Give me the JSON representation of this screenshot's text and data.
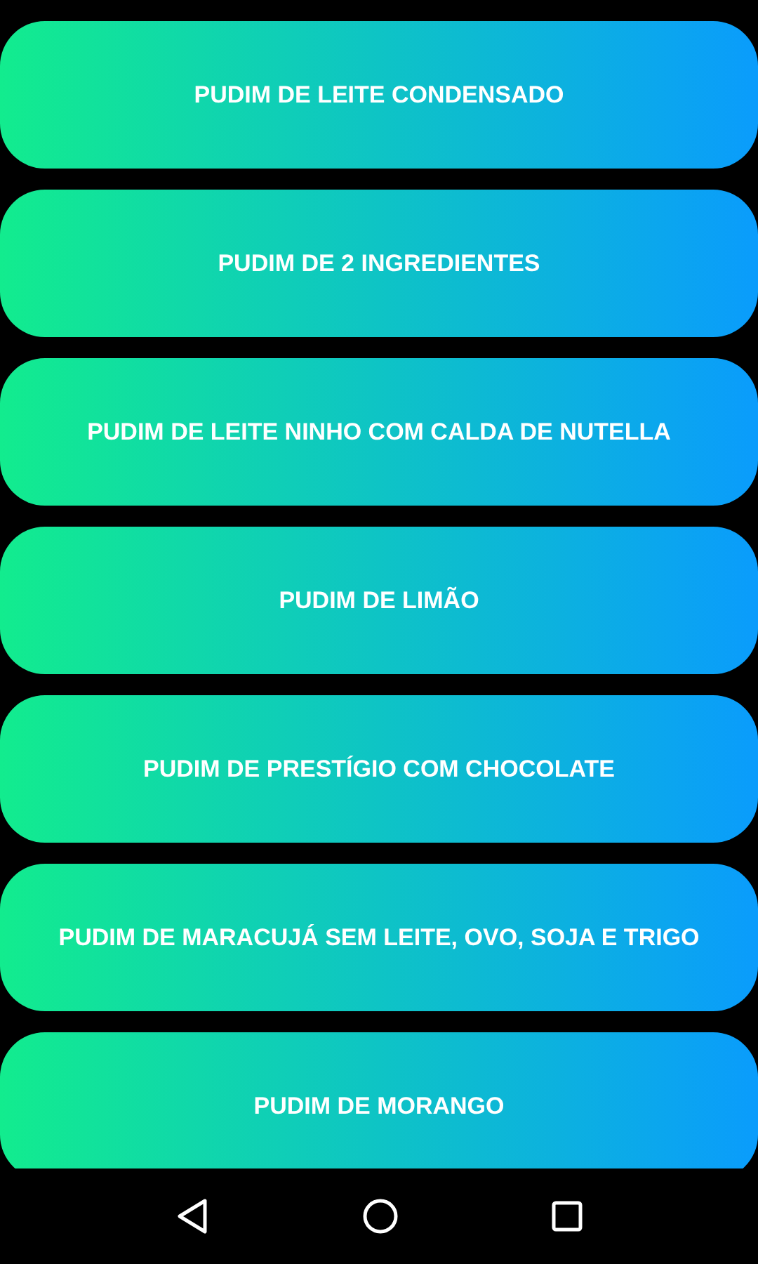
{
  "recipes": [
    {
      "label": "PUDIM DE LEITE CONDENSADO"
    },
    {
      "label": "PUDIM DE 2 INGREDIENTES"
    },
    {
      "label": "PUDIM DE LEITE NINHO COM CALDA DE NUTELLA"
    },
    {
      "label": "PUDIM DE LIMÃO"
    },
    {
      "label": "PUDIM DE PRESTÍGIO COM CHOCOLATE"
    },
    {
      "label": "PUDIM DE MARACUJÁ SEM LEITE, OVO, SOJA E TRIGO"
    },
    {
      "label": "PUDIM DE MORANGO"
    }
  ]
}
